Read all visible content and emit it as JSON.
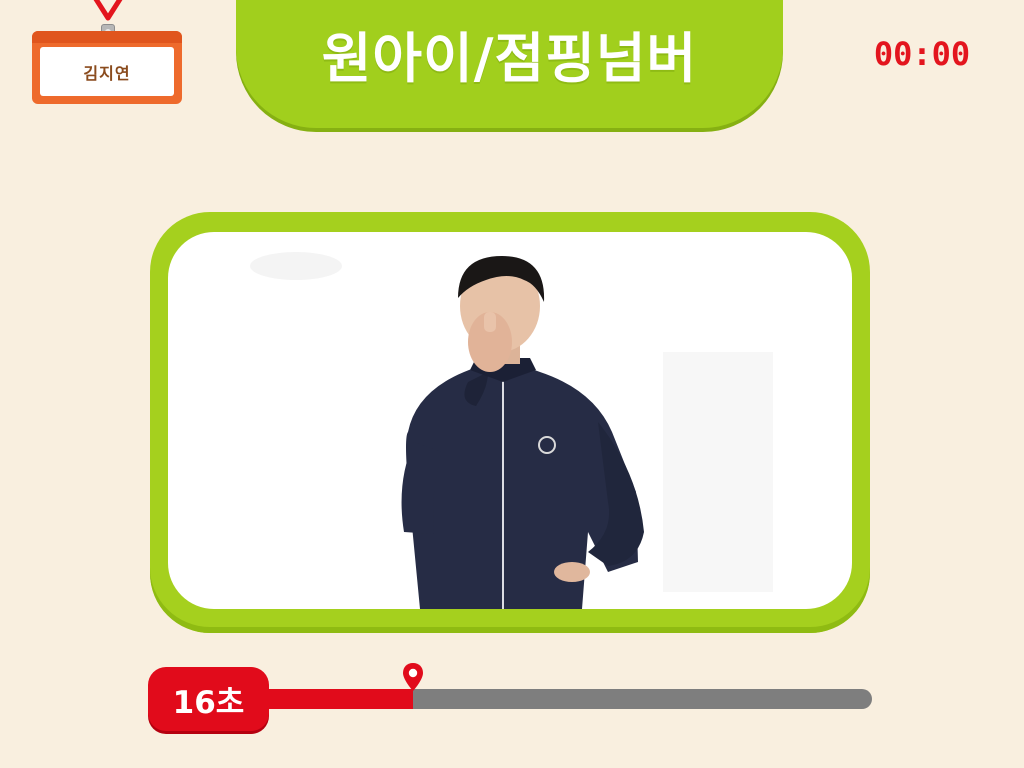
{
  "badge": {
    "name": "김지연"
  },
  "title": {
    "text": "원아이/점핑넘버"
  },
  "timer": {
    "text": "00:00"
  },
  "progress": {
    "label": "16초",
    "fraction": 0.24
  },
  "icons": {
    "lanyard": "lanyard-icon",
    "marker": "location-pin-icon"
  },
  "colors": {
    "accent_green": "#a1cf1d",
    "accent_red": "#e10b1b",
    "badge_orange": "#ee6a2c",
    "background": "#f9efdf"
  }
}
